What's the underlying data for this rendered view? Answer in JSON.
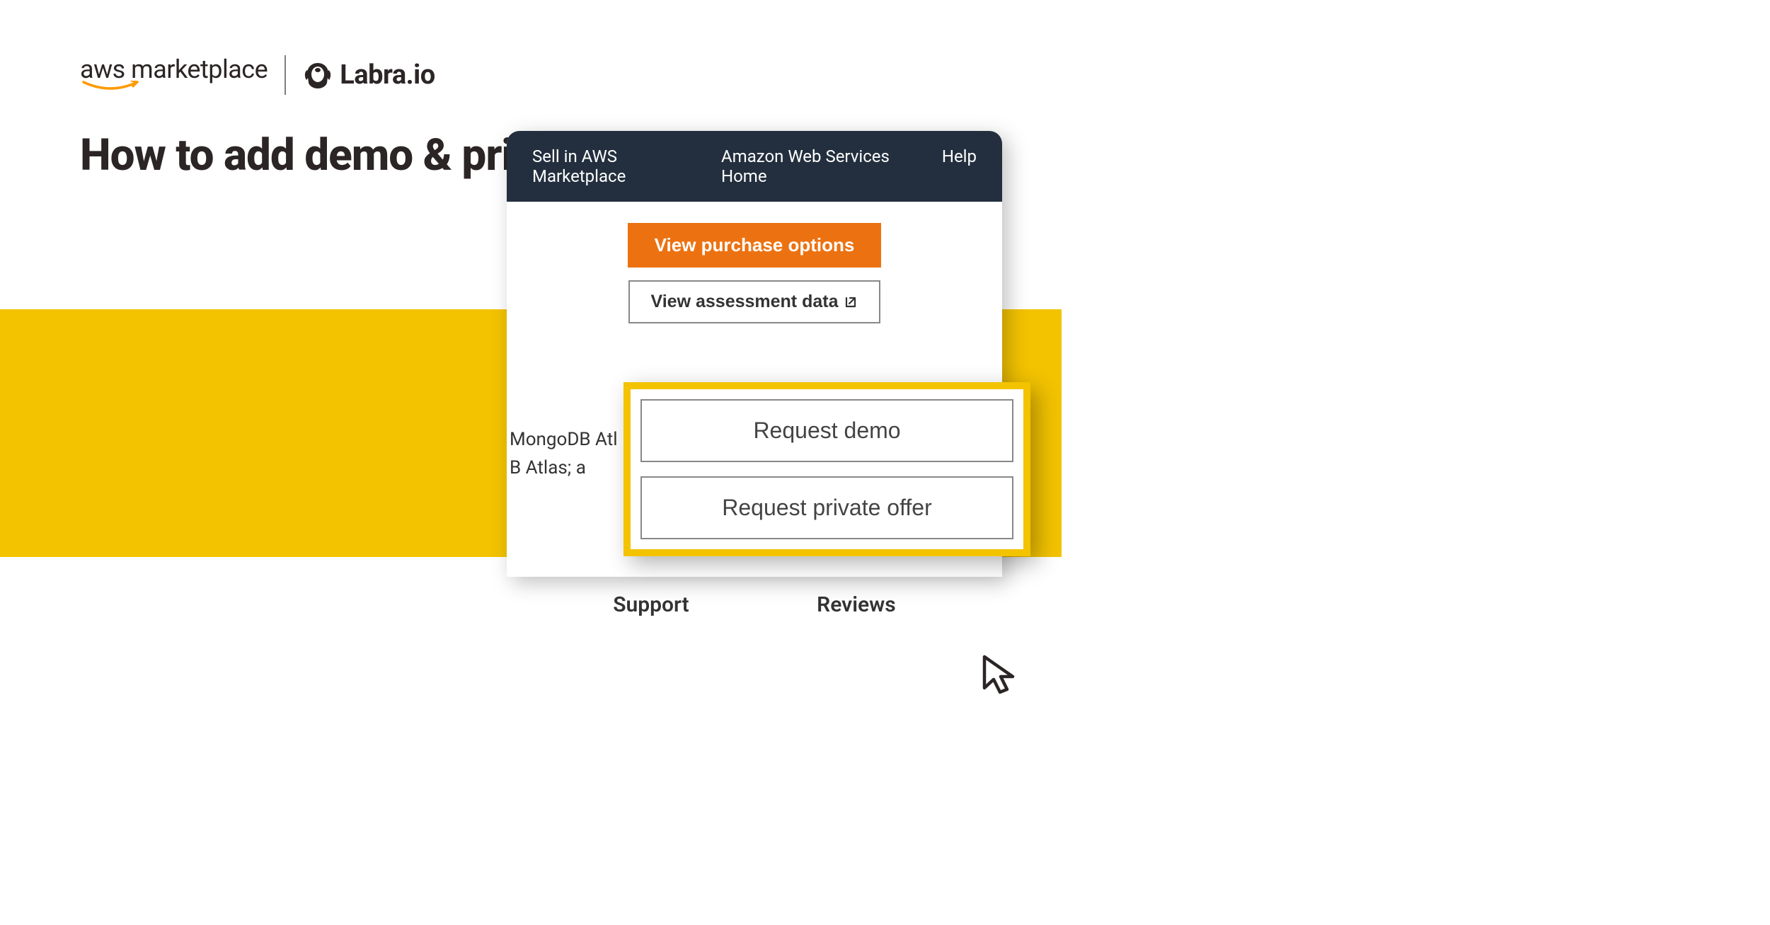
{
  "logos": {
    "aws": "aws marketplace",
    "labra": "Labra.io"
  },
  "heading": "How to add demo & private offer requests",
  "nav": {
    "sell": "Sell in AWS Marketplace",
    "home": "Amazon Web Services Home",
    "help": "Help"
  },
  "buttons": {
    "purchase": "View purchase options",
    "assessment": "View assessment data",
    "demo": "Request demo",
    "private_offer": "Request private offer"
  },
  "product_text_line1": "MongoDB Atl",
  "product_text_line2": "B Atlas; a",
  "tabs": {
    "support": "Support",
    "reviews": "Reviews"
  }
}
